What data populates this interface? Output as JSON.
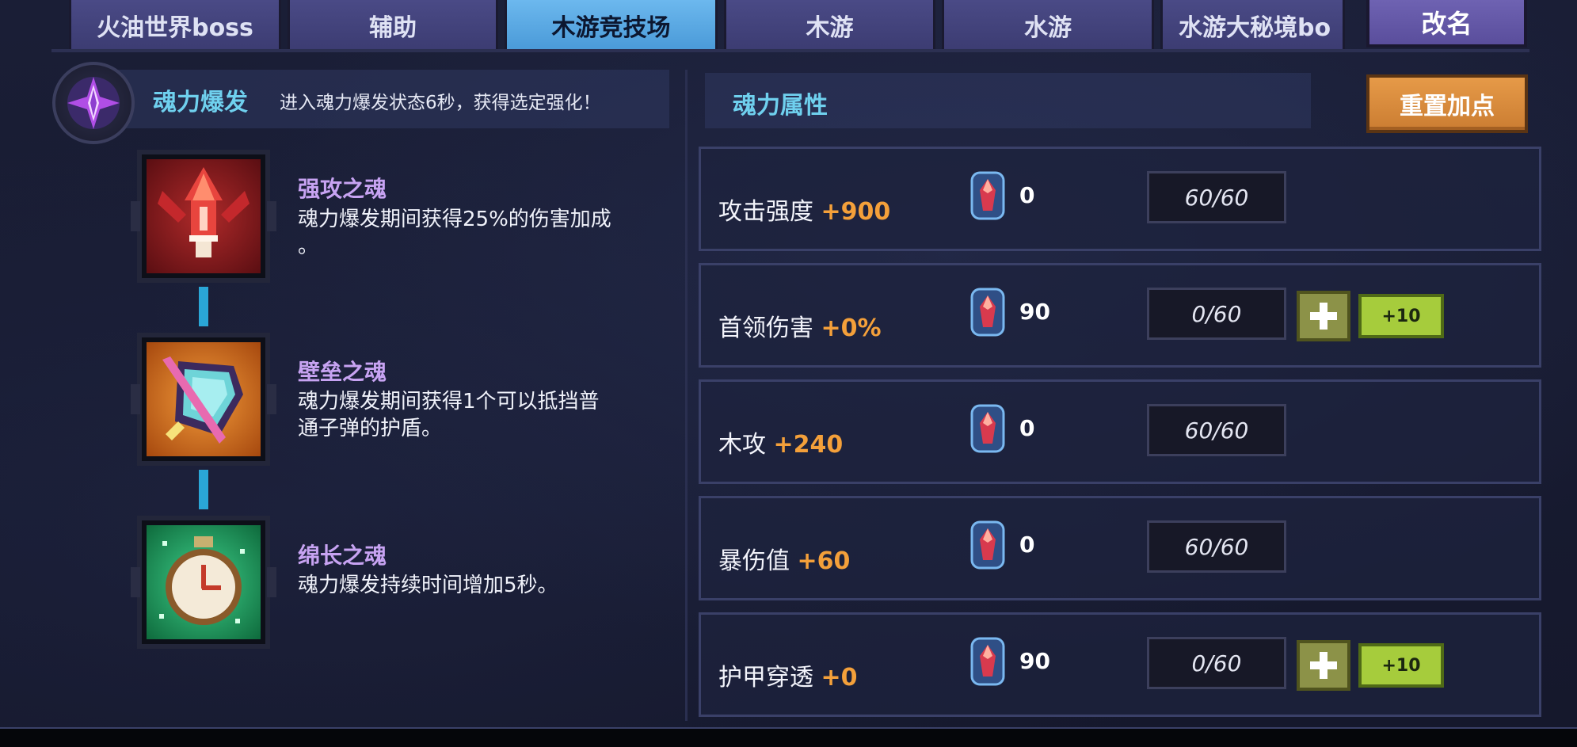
{
  "tabs": [
    {
      "label": "火油世界boss",
      "active": false
    },
    {
      "label": "辅助",
      "active": false
    },
    {
      "label": "木游竞技场",
      "active": true
    },
    {
      "label": "木游",
      "active": false
    },
    {
      "label": "水游",
      "active": false
    },
    {
      "label": "水游大秘境bo",
      "active": false
    }
  ],
  "rename_label": "改名",
  "burst": {
    "icon": "soul-crystal-icon",
    "title": "魂力爆发",
    "description": "进入魂力爆发状态6秒，获得选定强化！"
  },
  "skills": [
    {
      "icon": "strong-attack-soul-icon",
      "name": "强攻之魂",
      "description_line1": "魂力爆发期间获得25%的伤害加成",
      "description_line2": "。"
    },
    {
      "icon": "fortress-soul-icon",
      "name": "壁垒之魂",
      "description_line1": "魂力爆发期间获得1个可以抵挡普",
      "description_line2": "通子弹的护盾。"
    },
    {
      "icon": "lasting-soul-icon",
      "name": "绵长之魂",
      "description_line1": "魂力爆发持续时间增加5秒。",
      "description_line2": ""
    }
  ],
  "attributes": {
    "title": "魂力属性",
    "reset_label": "重置加点",
    "gem_icon": "soul-gem-icon",
    "rows": [
      {
        "name": "攻击强度",
        "bonus": "+900",
        "gems": "0",
        "level": "60/60",
        "upgradeable": false
      },
      {
        "name": "首领伤害",
        "bonus": "+0%",
        "gems": "90",
        "level": "0/60",
        "upgradeable": true,
        "plus10_label": "+10"
      },
      {
        "name": "木攻",
        "bonus": "+240",
        "gems": "0",
        "level": "60/60",
        "upgradeable": false
      },
      {
        "name": "暴伤值",
        "bonus": "+60",
        "gems": "0",
        "level": "60/60",
        "upgradeable": false
      },
      {
        "name": "护甲穿透",
        "bonus": "+0",
        "gems": "90",
        "level": "0/60",
        "upgradeable": true,
        "plus10_label": "+10"
      }
    ]
  },
  "colors": {
    "accent_cyan": "#6fd0ee",
    "bonus_orange": "#f4a03a",
    "skill_purple": "#c7a3f2",
    "active_tab": "#5aa8e4",
    "reset_orange": "#d98a3c",
    "plus_green": "#a6cc3c"
  }
}
